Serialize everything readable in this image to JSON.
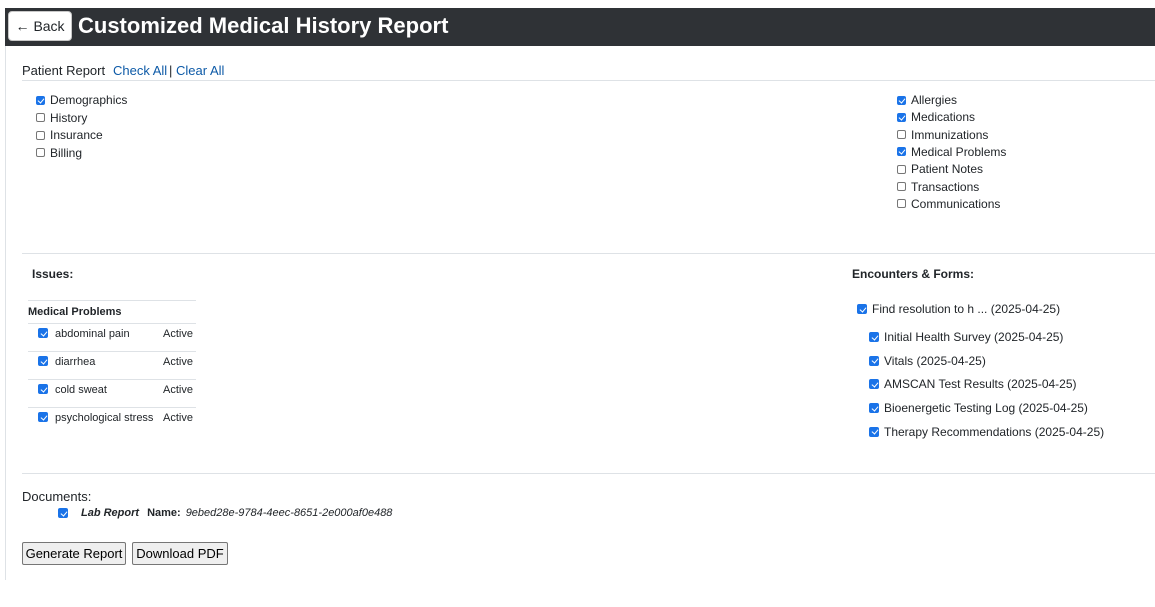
{
  "header": {
    "back_label": "Back",
    "title": "Customized Medical History Report"
  },
  "patient_report": {
    "label": "Patient Report",
    "check_all": "Check All",
    "separator": "|",
    "clear_all": "Clear All",
    "left_options": [
      {
        "label": "Demographics",
        "checked": true
      },
      {
        "label": "History",
        "checked": false
      },
      {
        "label": "Insurance",
        "checked": false
      },
      {
        "label": "Billing",
        "checked": false
      }
    ],
    "right_options": [
      {
        "label": "Allergies",
        "checked": true
      },
      {
        "label": "Medications",
        "checked": true
      },
      {
        "label": "Immunizations",
        "checked": false
      },
      {
        "label": "Medical Problems",
        "checked": true
      },
      {
        "label": "Patient Notes",
        "checked": false
      },
      {
        "label": "Transactions",
        "checked": false
      },
      {
        "label": "Communications",
        "checked": false
      }
    ]
  },
  "issues": {
    "title": "Issues:",
    "table_header": "Medical Problems",
    "rows": [
      {
        "name": "abdominal pain",
        "status": "Active",
        "checked": true
      },
      {
        "name": "diarrhea",
        "status": "Active",
        "checked": true
      },
      {
        "name": "cold sweat",
        "status": "Active",
        "checked": true
      },
      {
        "name": "psychological stress",
        "status": "Active",
        "checked": true
      }
    ]
  },
  "encounters": {
    "title": "Encounters & Forms:",
    "encounter": {
      "label": "Find resolution to h ... (2025-04-25)",
      "checked": true
    },
    "forms": [
      {
        "label": "Initial Health Survey (2025-04-25)",
        "checked": true
      },
      {
        "label": "Vitals (2025-04-25)",
        "checked": true
      },
      {
        "label": "AMSCAN Test Results (2025-04-25)",
        "checked": true
      },
      {
        "label": "Bioenergetic Testing Log (2025-04-25)",
        "checked": true
      },
      {
        "label": "Therapy Recommendations (2025-04-25)",
        "checked": true
      }
    ]
  },
  "documents": {
    "title": "Documents:",
    "item": {
      "category": "Lab Report",
      "name_label": "Name:",
      "name_value": "9ebed28e-9784-4eec-8651-2e000af0e488",
      "checked": true
    }
  },
  "actions": {
    "generate": "Generate Report",
    "download": "Download PDF"
  }
}
